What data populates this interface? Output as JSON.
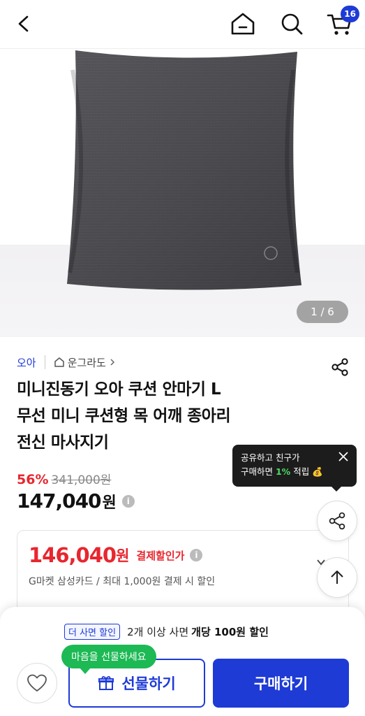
{
  "header": {
    "cart_count": "16"
  },
  "colors": {
    "accent": "#1e3bd6",
    "sale": "#e8262e",
    "tip_bg": "#1c1c1c",
    "gift_bubble": "#1db954"
  },
  "icons": [
    "chevron-left-icon",
    "home-icon",
    "search-icon",
    "cart-icon",
    "share-icon",
    "close-icon",
    "info-icon",
    "arrow-up-icon",
    "heart-icon",
    "gift-icon",
    "money-bag-icon",
    "chevron-right-icon"
  ],
  "gallery": {
    "pager": "1 / 6"
  },
  "product": {
    "brand": "오아",
    "shop": "운그라도",
    "title_lines": [
      "미니진동기 오아 쿠션 안마기 L",
      "무선 미니 쿠션형 목 어깨 종아리",
      "전신 마사지기"
    ],
    "discount_rate": "56%",
    "original_price": "341,000원",
    "price": "147,040",
    "price_unit": "원"
  },
  "tooltip": {
    "line1": "공유하고 친구가",
    "line2_pre": "구매하면 ",
    "line2_pct": "1%",
    "line2_post": " 적립",
    "icon_emoji": "💰"
  },
  "payment_card": {
    "amount": "146,040",
    "unit": "원",
    "label": "결제할인가",
    "desc": "G마켓 삼성카드 / 최대 1,000원 결제 시 할인"
  },
  "bottom": {
    "promo_badge": "더 사면 할인",
    "promo_text": "2개 이상 사면",
    "promo_strong": "개당 100원 할인",
    "gift_bubble": "마음을 선물하세요",
    "gift_label": "선물하기",
    "buy_label": "구매하기"
  }
}
